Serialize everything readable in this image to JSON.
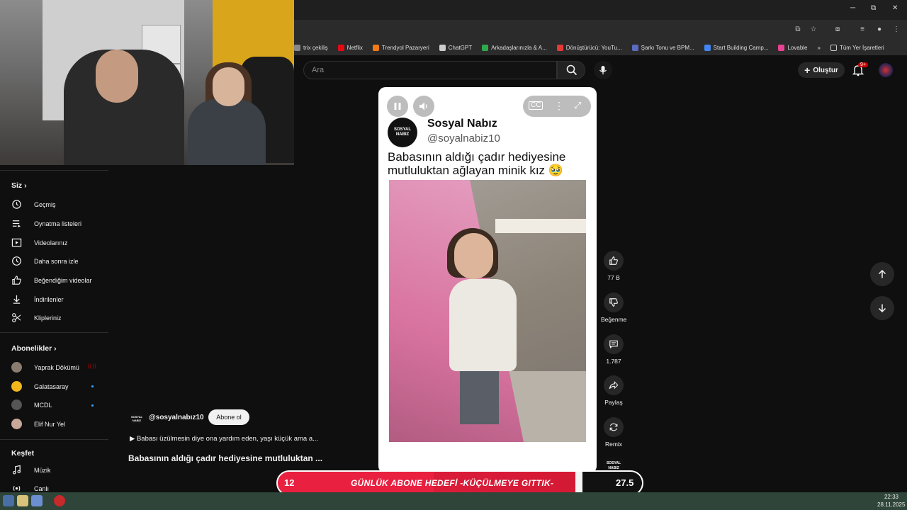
{
  "browser": {
    "window_controls": {
      "minimize": "─",
      "maximize": "⧉",
      "close": "✕"
    },
    "bookmarks": [
      {
        "label": "trix çekiliş",
        "color": "#888888"
      },
      {
        "label": "Netflix",
        "color": "#e50914"
      },
      {
        "label": "Trendyol Pazaryeri",
        "color": "#f27a1a"
      },
      {
        "label": "ChatGPT",
        "color": "#cccccc"
      },
      {
        "label": "Arkadaşlarınızla & A...",
        "color": "#2eaa4a"
      },
      {
        "label": "Dönüştürücü: YouTu...",
        "color": "#e53935"
      },
      {
        "label": "Şarkı Tonu ve BPM...",
        "color": "#5c6bc0"
      },
      {
        "label": "Start Building Camp...",
        "color": "#4285f4"
      },
      {
        "label": "Lovable",
        "color": "#e84393"
      }
    ],
    "bookmarks_more": "»",
    "all_bookmarks": "Tüm Yer İşaretleri"
  },
  "header": {
    "search_placeholder": "Ara",
    "create_label": "Oluştur",
    "notification_badge": "9+"
  },
  "sidebar": {
    "you_title": "Siz",
    "you_items": [
      {
        "label": "Geçmiş",
        "icon": "history-icon"
      },
      {
        "label": "Oynatma listeleri",
        "icon": "playlist-icon"
      },
      {
        "label": "Videolarınız",
        "icon": "your-videos-icon"
      },
      {
        "label": "Daha sonra izle",
        "icon": "watch-later-icon"
      },
      {
        "label": "Beğendiğim videolar",
        "icon": "liked-icon"
      },
      {
        "label": "İndirilenler",
        "icon": "download-icon"
      },
      {
        "label": "Klipleriniz",
        "icon": "scissors-icon"
      }
    ],
    "subs_title": "Abonelikler",
    "subs": [
      {
        "label": "Yaprak Dökümü",
        "color": "#8a7d70",
        "live": true
      },
      {
        "label": "Galatasaray",
        "color": "#f1b51c",
        "dot": true
      },
      {
        "label": "MCDL",
        "color": "#555555",
        "dot": true
      },
      {
        "label": "Elif Nur Yel",
        "color": "#c9a89a",
        "dot": false
      }
    ],
    "explore_title": "Keşfet",
    "explore_items": [
      {
        "label": "Müzik",
        "icon": "music-icon"
      },
      {
        "label": "Canlı",
        "icon": "live-icon"
      }
    ]
  },
  "short": {
    "post_name": "Sosyal Nabız",
    "post_handle": "@soyalnabiz10",
    "logo_text": "SOSYAL NABIZ",
    "caption": "Babasının aldığı çadır hediyesine mutluluktan ağlayan minik kız 🥹",
    "likes": "77 B",
    "dislike_label": "Beğenme",
    "comments": "1.787",
    "share_label": "Paylaş",
    "remix_label": "Remix"
  },
  "meta": {
    "handle": "@sosyalnabız10",
    "subscribe_label": "Abone ol",
    "description": "▶ Babası üzülmesin diye ona yardım eden, yaşı küçük ama a...",
    "title": "Babasının aldığı çadır hediyesine mutluluktan ..."
  },
  "overlay": {
    "count": "12",
    "text": "GÜNLÜK ABONE HEDEFİ -KÜÇÜLMEYE GITTIK-",
    "value": "27.5"
  },
  "taskbar": {
    "time": "22:33",
    "date": "28.11.2025"
  }
}
